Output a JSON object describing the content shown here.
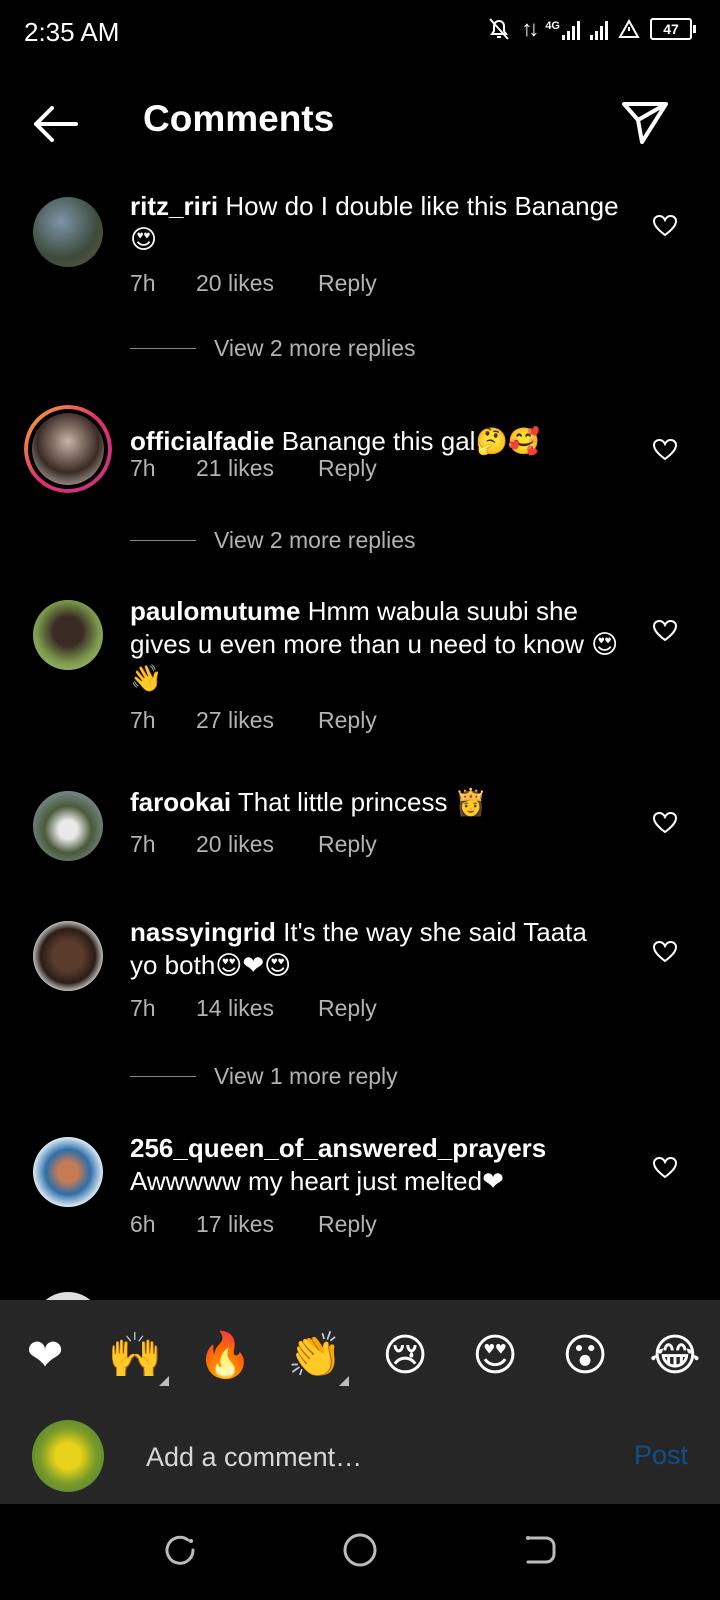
{
  "status_bar": {
    "time": "2:35 AM",
    "network": "4G",
    "battery": "47"
  },
  "header": {
    "title": "Comments"
  },
  "comments": [
    {
      "username": "ritz_riri",
      "text": "How do I double like this Banange",
      "emoji": "😍",
      "time": "7h",
      "likes": "20 likes",
      "reply": "Reply",
      "view_replies": "View 2 more replies"
    },
    {
      "username": "officialfadie",
      "text": "Banange this gal",
      "emoji": "🤔🥰",
      "time": "7h",
      "likes": "21 likes",
      "reply": "Reply",
      "view_replies": "View 2 more replies"
    },
    {
      "username": "paulomutume",
      "text": "Hmm wabula suubi she gives u even more than u need to know",
      "emoji": "😍👋",
      "time": "7h",
      "likes": "27 likes",
      "reply": "Reply"
    },
    {
      "username": "farookai",
      "text": "That little princess",
      "emoji": "👸",
      "time": "7h",
      "likes": "20 likes",
      "reply": "Reply"
    },
    {
      "username": "nassyingrid",
      "text": "It's the way she said Taata yo both",
      "emoji": "😍❤😍",
      "time": "7h",
      "likes": "14 likes",
      "reply": "Reply",
      "view_replies": "View 1 more reply"
    },
    {
      "username": "256_queen_of_answered_prayers",
      "text": "Awwwww my heart just melted",
      "emoji": "❤",
      "time": "6h",
      "likes": "17 likes",
      "reply": "Reply"
    }
  ],
  "emoji_bar": [
    "❤",
    "🙌",
    "🔥",
    "👏",
    "😢",
    "😍",
    "😮",
    "😂"
  ],
  "comment_input": {
    "placeholder": "Add a comment…",
    "post_label": "Post"
  },
  "colors": {
    "background": "#000000",
    "panel": "#262626",
    "post_disabled": "#0d4f86",
    "meta_text": "#b3b3b3"
  }
}
